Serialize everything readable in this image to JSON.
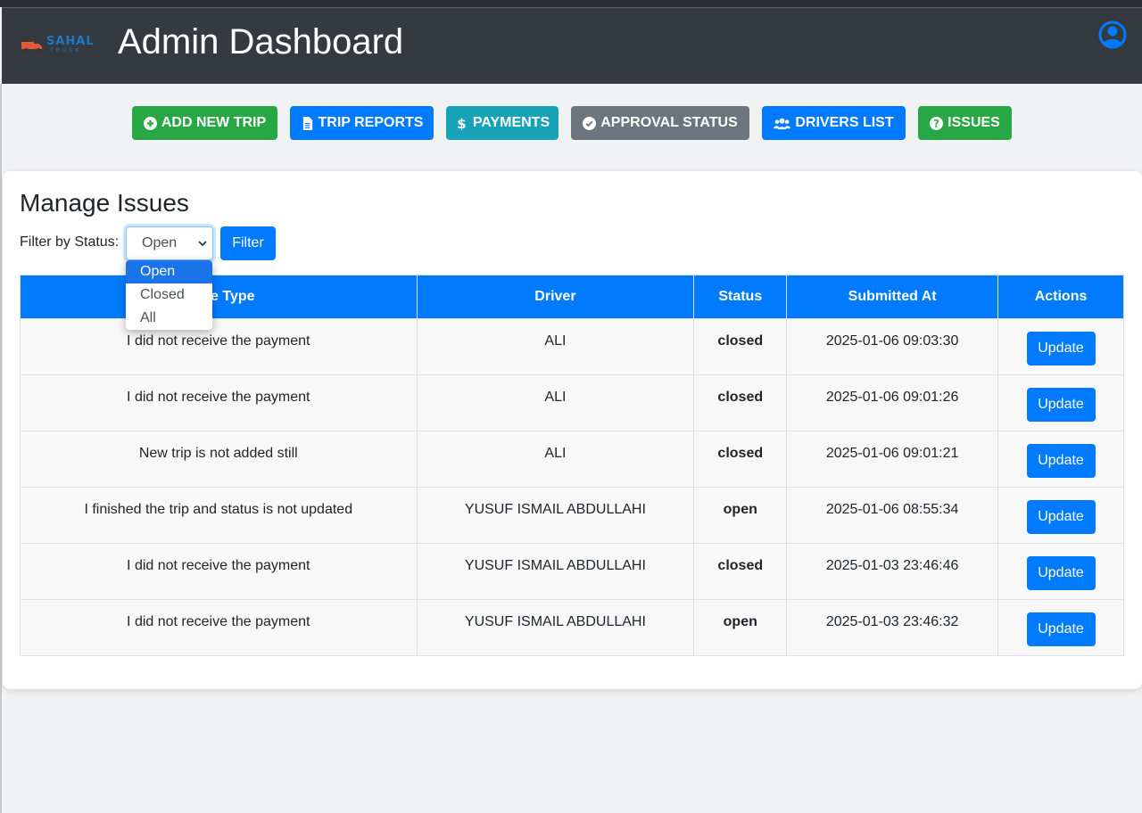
{
  "header": {
    "brand": "SAHAL",
    "brand_sub": "TRUCK",
    "title": "Admin Dashboard"
  },
  "nav": [
    {
      "label": "ADD NEW TRIP",
      "icon": "plus-circle-icon",
      "color": "#28a745"
    },
    {
      "label": "TRIP REPORTS",
      "icon": "file-icon",
      "color": "#007bff"
    },
    {
      "label": "PAYMENTS",
      "icon": "dollar-icon",
      "color": "#17a2b8"
    },
    {
      "label": "APPROVAL STATUS",
      "icon": "check-circle-icon",
      "color": "#6c757d"
    },
    {
      "label": "DRIVERS LIST",
      "icon": "users-icon",
      "color": "#007bff"
    },
    {
      "label": "ISSUES",
      "icon": "question-circle-icon",
      "color": "#28a745"
    }
  ],
  "issues": {
    "title": "Manage Issues",
    "filter_label": "Filter by Status:",
    "filter_selected": "Open",
    "filter_options": [
      "Open",
      "Closed",
      "All"
    ],
    "filter_button": "Filter",
    "columns": [
      "Issue Type",
      "Driver",
      "Status",
      "Submitted At",
      "Actions"
    ],
    "visible_header_fragment": "e Type",
    "rows": [
      {
        "type": "I did not receive the payment",
        "driver": "ALI",
        "status": "closed",
        "submitted": "2025-01-06 09:03:30",
        "action": "Update"
      },
      {
        "type": "I did not receive the payment",
        "driver": "ALI",
        "status": "closed",
        "submitted": "2025-01-06 09:01:26",
        "action": "Update"
      },
      {
        "type": "New trip is not added still",
        "driver": "ALI",
        "status": "closed",
        "submitted": "2025-01-06 09:01:21",
        "action": "Update"
      },
      {
        "type": "I finished the trip and status is not updated",
        "driver": "YUSUF ISMAIL ABDULLAHI",
        "status": "open",
        "submitted": "2025-01-06 08:55:34",
        "action": "Update"
      },
      {
        "type": "I did not receive the payment",
        "driver": "YUSUF ISMAIL ABDULLAHI",
        "status": "closed",
        "submitted": "2025-01-03 23:46:46",
        "action": "Update"
      },
      {
        "type": "I did not receive the payment",
        "driver": "YUSUF ISMAIL ABDULLAHI",
        "status": "open",
        "submitted": "2025-01-03 23:46:32",
        "action": "Update"
      }
    ]
  },
  "colors": {
    "header_bg": "#343a40",
    "primary": "#007bff",
    "status_closed": "#008000",
    "status_open": "#e00000"
  }
}
